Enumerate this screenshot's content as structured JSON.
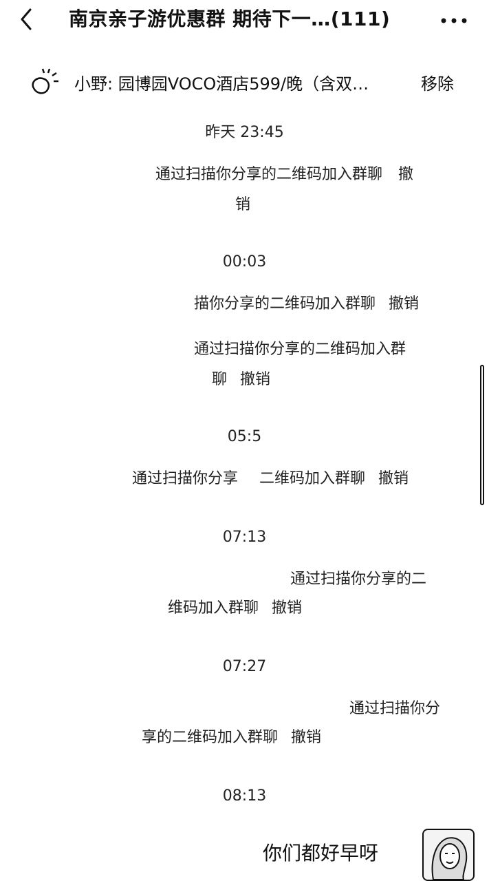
{
  "header": {
    "back_icon": "chevron-left-icon",
    "title": "南京亲子游优惠群 期待下一…(111)",
    "more_icon": "more-dots-icon"
  },
  "pinned": {
    "icon": "pin-avatar-icon",
    "text": "小野: 园博园VOCO酒店599/晚（含双…",
    "remove_label": "移除"
  },
  "messages": [
    {
      "time": "昨天 23:45",
      "lines": [
        "通过扫描你分享的二维码加入群聊",
        "销"
      ],
      "revoke": "撤"
    },
    {
      "time": "00:03",
      "lines": [
        "描你分享的二维码加入群聊"
      ],
      "revoke": "撤销"
    },
    {
      "lines": [
        "通过扫描你分享的二维码加入群",
        "聊"
      ],
      "revoke": "撤销"
    },
    {
      "time": "05:5",
      "lines": [
        "通过扫描你分享",
        "二维码加入群聊"
      ],
      "revoke": "撤销"
    },
    {
      "time": "07:13",
      "lines": [
        "通过扫描你分享的二",
        "维码加入群聊"
      ],
      "revoke": "撤销"
    },
    {
      "time": "07:27",
      "lines": [
        "通过扫描你分",
        "享的二维码加入群聊"
      ],
      "revoke": "撤销"
    },
    {
      "time": "08:13"
    }
  ],
  "chat": {
    "bubble_text": "你们都好早呀",
    "avatar_icon": "user-avatar-icon"
  },
  "colors": {
    "background": "#ffffff",
    "text": "#111111"
  }
}
